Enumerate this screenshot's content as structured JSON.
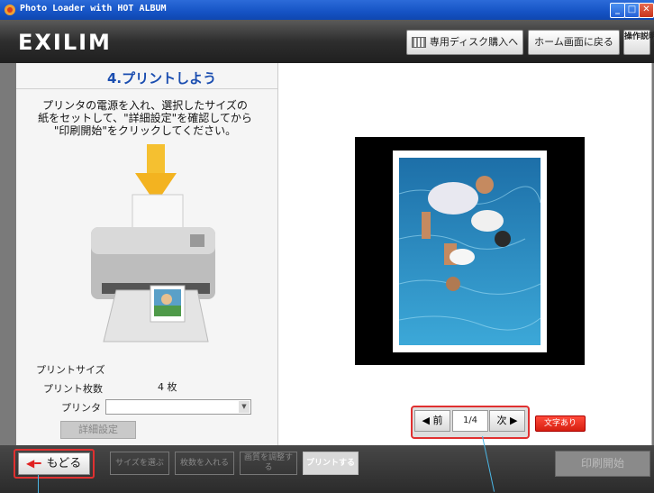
{
  "window": {
    "title": "Photo Loader with HOT ALBUM"
  },
  "header": {
    "logo": "EXILIM",
    "buy_disk_label": "専用ディスク購入へ",
    "home_label": "ホーム画面に戻る",
    "manual_label": "操作説明"
  },
  "left": {
    "step_title": "4.プリントしよう",
    "instructions": "プリンタの電源を入れ、選択したサイズの\n紙をセットして、\"詳細設定\"を確認してから\n\"印刷開始\"をクリックしてください。",
    "print_size_label": "プリントサイズ",
    "print_count_label": "プリント枚数",
    "print_count_value": "4 枚",
    "printer_label": "プリンタ",
    "detail_button": "詳細設定"
  },
  "pager": {
    "prev_label": "◀ 前",
    "page_indicator": "1/4",
    "next_label": "次 ▶",
    "text_toggle": "文字あり"
  },
  "bottom": {
    "back_label": "もどる",
    "steps": [
      "サイズを選ぶ",
      "枚数を入れる",
      "画質を調整する",
      "プリントする"
    ],
    "print_start": "印刷開始"
  },
  "colors": {
    "accent_red": "#e03030",
    "title_blue": "#1a4db0"
  }
}
